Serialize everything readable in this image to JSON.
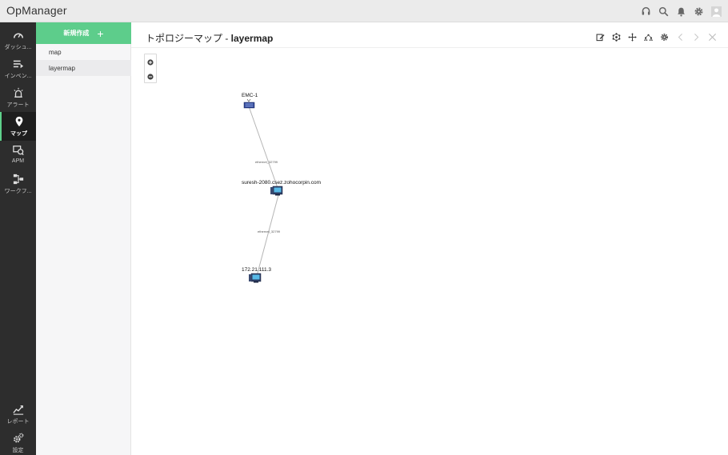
{
  "app": {
    "title": "OpManager"
  },
  "nav": {
    "dashboard": "ダッシュ...",
    "inventory": "インベン...",
    "alerts": "アラート",
    "maps": "マップ",
    "apm": "APM",
    "workflow": "ワークフ...",
    "reports": "レポート",
    "settings": "設定"
  },
  "maps_panel": {
    "new_label": "新規作成",
    "new_icon": "plus-icon",
    "items": [
      {
        "label": "map"
      },
      {
        "label": "layermap"
      }
    ]
  },
  "content": {
    "title_prefix": "トポロジーマップ - ",
    "title_name": "layermap"
  },
  "topology": {
    "nodes": [
      {
        "label": "EMC-1",
        "kind": "storage"
      },
      {
        "label": "suresh-2080.csez.zohocorpin.com",
        "kind": "server"
      },
      {
        "label": "172.21.111.3",
        "kind": "server"
      }
    ],
    "links": [
      {
        "label": "ethernet_32799"
      },
      {
        "label": "ethernet_32799"
      }
    ]
  },
  "colors": {
    "accent": "#5dcd8b",
    "nav_bg": "#2d2d2d",
    "topbar_bg": "#ebebeb",
    "link": "#b5b5b5"
  }
}
